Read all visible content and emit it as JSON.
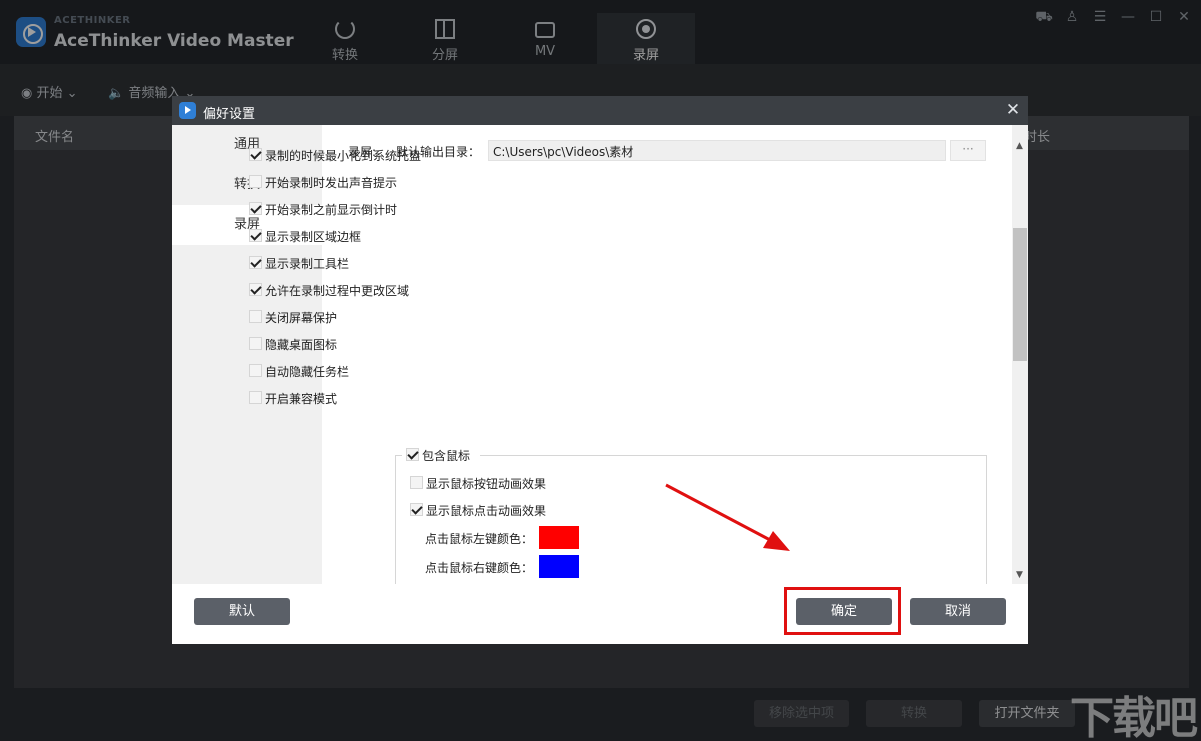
{
  "app": {
    "brand_small": "ACETHINKER",
    "brand_name": "AceThinker Video Master",
    "tabs": [
      {
        "label": "转换",
        "icon": "convert-icon"
      },
      {
        "label": "分屏",
        "icon": "split-screen-icon"
      },
      {
        "label": "MV",
        "icon": "mv-icon"
      },
      {
        "label": "录屏",
        "icon": "record-screen-icon"
      }
    ],
    "window_controls": [
      "cart-icon",
      "user-icon",
      "menu-icon",
      "minimize-icon",
      "maximize-icon",
      "close-icon"
    ]
  },
  "toolbar": {
    "start_label": "开始",
    "audio_label": "音频输入"
  },
  "list": {
    "col_filename": "文件名",
    "col_duration": "时长"
  },
  "footer": {
    "remove_label": "移除选中项",
    "convert_label": "转换",
    "open_folder_label": "打开文件夹"
  },
  "watermark": "下载吧",
  "dialog": {
    "title": "偏好设置",
    "sidebar": [
      {
        "label": "通用"
      },
      {
        "label": "转换"
      },
      {
        "label": "录屏"
      }
    ],
    "section_label": "录屏:",
    "output_dir_label": "默认输出目录：",
    "output_dir_value": "C:\\Users\\pc\\Videos\\素材",
    "browse_label": "···",
    "options": [
      {
        "label": "录制的时候最小化到系统托盘",
        "checked": true
      },
      {
        "label": "开始录制时发出声音提示",
        "checked": false
      },
      {
        "label": "开始录制之前显示倒计时",
        "checked": true
      },
      {
        "label": "显示录制区域边框",
        "checked": true
      },
      {
        "label": "显示录制工具栏",
        "checked": true
      },
      {
        "label": "允许在录制过程中更改区域",
        "checked": true
      },
      {
        "label": "关闭屏幕保护",
        "checked": false
      },
      {
        "label": "隐藏桌面图标",
        "checked": false
      },
      {
        "label": "自动隐藏任务栏",
        "checked": false
      },
      {
        "label": "开启兼容模式",
        "checked": false
      }
    ],
    "mouse_group": {
      "label": "包含鼠标",
      "checked": true,
      "options": [
        {
          "label": "显示鼠标按钮动画效果",
          "checked": false
        },
        {
          "label": "显示鼠标点击动画效果",
          "checked": true
        }
      ],
      "left_color_label": "点击鼠标左键颜色：",
      "left_color": "#ff0000",
      "right_color_label": "点击鼠标右键颜色：",
      "right_color": "#0000ff"
    },
    "default_button": "默认",
    "ok_button": "确定",
    "cancel_button": "取消"
  },
  "colors": {
    "annotation_red": "#e01010",
    "button_gray": "#5b6068"
  }
}
